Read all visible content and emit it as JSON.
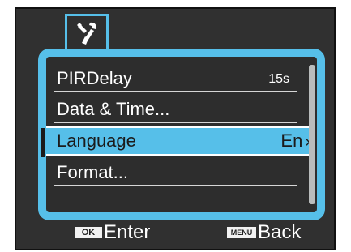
{
  "menu": {
    "items": [
      {
        "label": "PIRDelay",
        "value": "15s"
      },
      {
        "label": "Data & Time..."
      },
      {
        "label": "Language",
        "value": "En",
        "selected": true
      },
      {
        "label": "Format..."
      }
    ]
  },
  "tab": {
    "icon": "wrench-screwdriver-icon"
  },
  "footer": {
    "ok_key": "OK",
    "enter_label": "Enter",
    "menu_key": "MENU",
    "back_label": "Back"
  },
  "colors": {
    "accent": "#56bfe9",
    "screen_bg": "#303030",
    "text": "#ffffff"
  }
}
